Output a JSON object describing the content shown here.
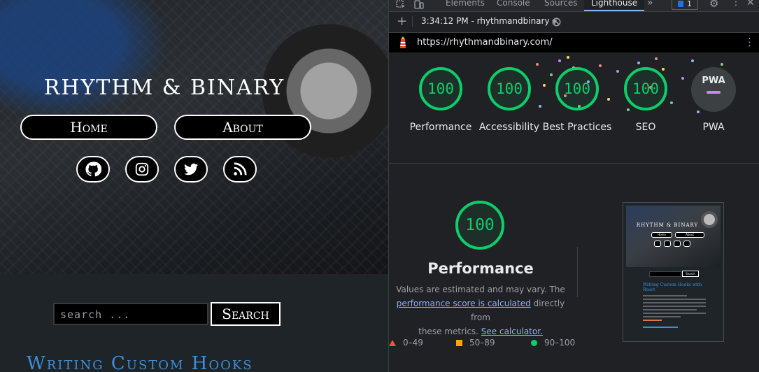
{
  "site": {
    "title": "Rhythm & Binary",
    "nav": [
      {
        "label": "Home"
      },
      {
        "label": "About"
      }
    ],
    "social": [
      "github-icon",
      "instagram-icon",
      "twitter-icon",
      "rss-icon"
    ],
    "search": {
      "placeholder": "search ...",
      "button_label": "Search"
    },
    "post_title": "Writing Custom Hooks"
  },
  "devtools": {
    "tabs": [
      "Elements",
      "Console",
      "Sources",
      "Lighthouse"
    ],
    "active_tab": "Lighthouse",
    "issues_badge": "1",
    "report_selector": "3:34:12 PM - rhythmandbinary",
    "url": "https://rhythmandbinary.com/",
    "categories": [
      {
        "label": "Performance",
        "score": "100"
      },
      {
        "label": "Accessibility",
        "score": "100"
      },
      {
        "label": "Best Practices",
        "score": "100"
      },
      {
        "label": "SEO",
        "score": "100"
      },
      {
        "label": "PWA",
        "score": ""
      }
    ],
    "pwa_badge": "PWA",
    "performance": {
      "score": "100",
      "title": "Performance",
      "desc_1": "Values are estimated and may vary. The",
      "link_1": "performance score is calculated",
      "desc_2": " directly from",
      "desc_3": "these metrics. ",
      "link_2": "See calculator."
    },
    "legend": [
      {
        "range": "0–49",
        "color": "#ff4e42",
        "shape": "triangle"
      },
      {
        "range": "50–89",
        "color": "#ffa400",
        "shape": "square"
      },
      {
        "range": "90–100",
        "color": "#0cce6b",
        "shape": "circle"
      }
    ],
    "thumbnail": {
      "title": "Rhythm & Binary",
      "nav": [
        "Home",
        "About"
      ],
      "search_label": "Search",
      "post_title": "Writing Custom Hooks with React"
    },
    "colors": {
      "pass": "#0cce6b",
      "link": "#8ab4f8",
      "tab_accent": "#8ab4f8"
    }
  }
}
